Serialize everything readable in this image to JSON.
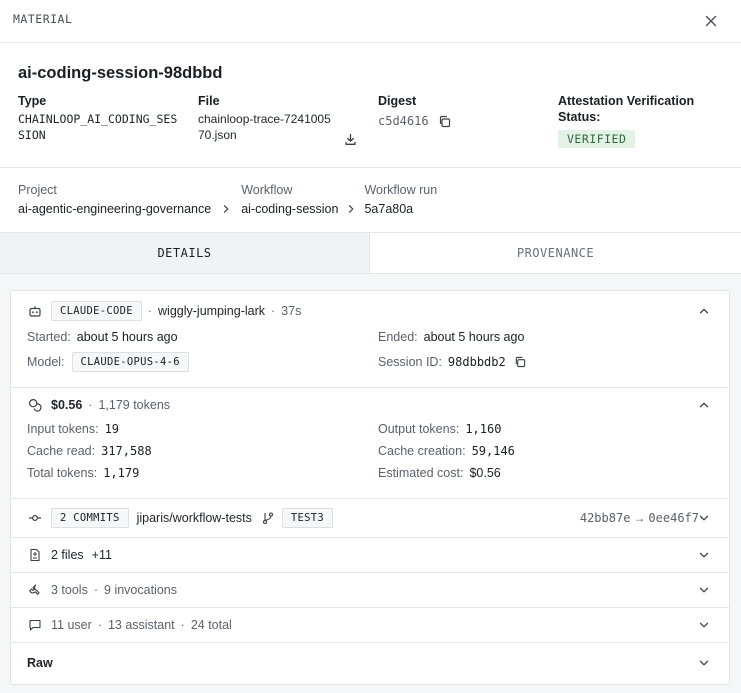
{
  "header": {
    "kicker": "MATERIAL"
  },
  "material": {
    "name": "ai-coding-session-98dbbd",
    "type_label": "Type",
    "type_value": "CHAINLOOP_AI_CODING_SESSION",
    "file_label": "File",
    "file_value": "chainloop-trace-724100570.json",
    "digest_label": "Digest",
    "digest_value": "c5d4616",
    "attestation_label": "Attestation Verification Status:",
    "attestation_status": "VERIFIED"
  },
  "breadcrumb": {
    "project_label": "Project",
    "project_value": "ai-agentic-engineering-governance",
    "workflow_label": "Workflow",
    "workflow_value": "ai-coding-session",
    "run_label": "Workflow run",
    "run_value": "5a7a80a"
  },
  "tabs": {
    "details": "DETAILS",
    "provenance": "PROVENANCE",
    "active": "DETAILS"
  },
  "session": {
    "agent": "CLAUDE-CODE",
    "name": "wiggly-jumping-lark",
    "duration": "37s",
    "started_label": "Started:",
    "started_value": "about 5 hours ago",
    "ended_label": "Ended:",
    "ended_value": "about 5 hours ago",
    "model_label": "Model:",
    "model_value": "CLAUDE-OPUS-4-6",
    "session_id_label": "Session ID:",
    "session_id_value": "98dbbdb2"
  },
  "cost": {
    "total": "$0.56",
    "tokens_summary": "1,179 tokens",
    "input_label": "Input tokens:",
    "input_value": "19",
    "output_label": "Output tokens:",
    "output_value": "1,160",
    "cache_read_label": "Cache read:",
    "cache_read_value": "317,588",
    "cache_creation_label": "Cache creation:",
    "cache_creation_value": "59,146",
    "total_label": "Total tokens:",
    "total_value": "1,179",
    "estimated_label": "Estimated cost:",
    "estimated_value": "$0.56"
  },
  "commits": {
    "count": "2 COMMITS",
    "repo": "jiparis/workflow-tests",
    "branch": "TEST3",
    "from": "42bb87e",
    "arrow": "→",
    "to": "0ee46f7"
  },
  "files": {
    "count": "2 files",
    "added": "+11"
  },
  "tools": {
    "summary": "3 tools",
    "invocations": "9 invocations"
  },
  "messages": {
    "user": "11 user",
    "assistant": "13 assistant",
    "total": "24 total"
  },
  "raw": {
    "label": "Raw"
  },
  "colors": {
    "verified_bg": "#e3f1e6",
    "verified_text": "#2d6b3a",
    "active_tab_bg": "#f1f2f4"
  },
  "icons": [
    "close-icon",
    "download-icon",
    "copy-icon",
    "chevron-right-icon",
    "robot-icon",
    "coins-icon",
    "commit-icon",
    "git-branch-icon",
    "file-diff-icon",
    "wrench-icon",
    "chat-icon",
    "chevron-up-icon",
    "chevron-down-icon"
  ]
}
